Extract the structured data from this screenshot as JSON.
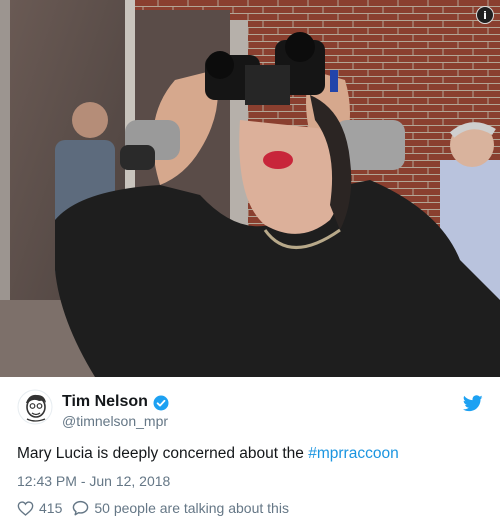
{
  "tweet": {
    "user_name": "Tim Nelson",
    "handle": "@timnelson_mpr",
    "text_before": "Mary Lucia is deeply concerned about the ",
    "hashtag": "#mprraccoon",
    "timestamp": "12:43 PM - Jun 12, 2018",
    "like_count": "415",
    "talking_text": "50 people are talking about this"
  },
  "icons": {
    "info": "info-icon",
    "verified": "verified-badge-icon",
    "twitter": "twitter-bird-icon",
    "like": "heart-icon",
    "reply": "speech-bubble-icon"
  },
  "colors": {
    "twitter_blue": "#1da1f2",
    "link_blue": "#1b95e0",
    "secondary_text": "#657786",
    "primary_text": "#14171a"
  }
}
